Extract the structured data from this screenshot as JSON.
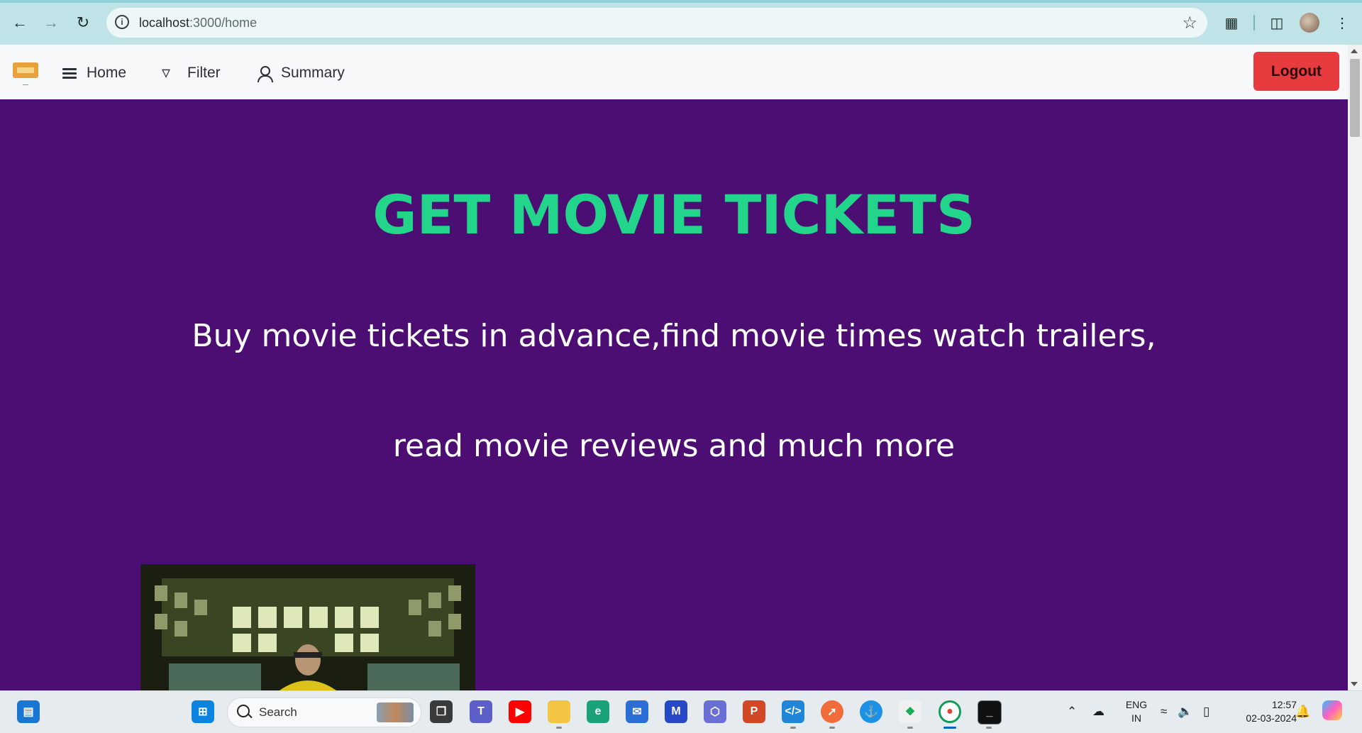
{
  "browser": {
    "url_host": "localhost",
    "url_path": ":3000/home"
  },
  "nav": {
    "home": "Home",
    "filter": "Filter",
    "summary": "Summary",
    "logout": "Logout"
  },
  "hero": {
    "title": "GET MOVIE TICKETS",
    "line1": "Buy movie tickets in advance,find movie times watch trailers,",
    "line2": "read movie reviews and much more"
  },
  "taskbar": {
    "search_placeholder": "Search",
    "lang": "ENG",
    "region": "IN",
    "time": "12:57",
    "date": "02-03-2024"
  },
  "colors": {
    "page_bg": "#4d0e74",
    "title": "#22d58b",
    "logout_bg": "#e83b3f"
  }
}
